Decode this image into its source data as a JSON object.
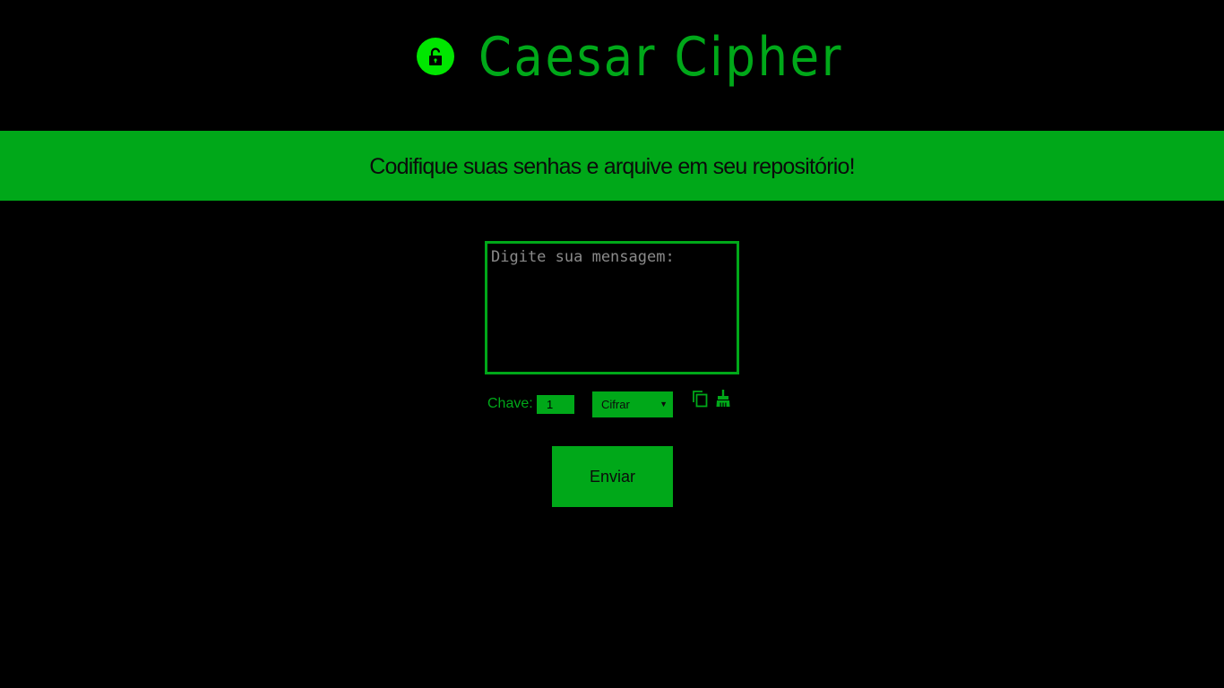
{
  "header": {
    "title": "Caesar Cipher",
    "logo_icon": "lock-icon"
  },
  "banner": {
    "text": "Codifique suas senhas e arquive em seu repositório!"
  },
  "form": {
    "message_placeholder": "Digite sua mensagem:",
    "message_value": "",
    "key_label": "Chave:",
    "key_value": "1",
    "mode_selected": "Cifrar",
    "copy_icon": "copy-icon",
    "clear_icon": "broom-icon",
    "submit_label": "Enviar"
  },
  "colors": {
    "background": "#000000",
    "accent": "#00a819",
    "logo": "#00e600"
  }
}
